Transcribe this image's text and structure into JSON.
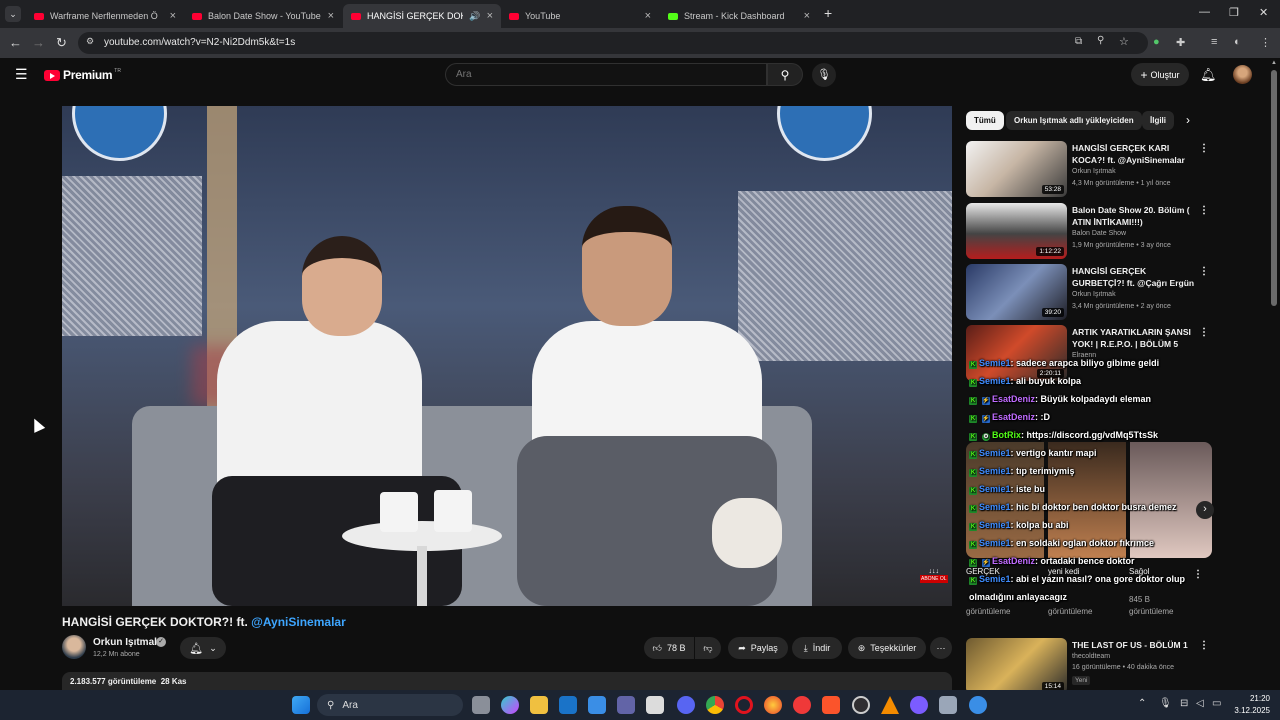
{
  "browser": {
    "tabs": [
      {
        "title": "Warframe Nerflenmeden Ö",
        "active": false
      },
      {
        "title": "Balon Date Show - YouTube",
        "active": false
      },
      {
        "title": "HANGİSİ GERÇEK DOKTOR",
        "active": true
      },
      {
        "title": "YouTube",
        "active": false
      },
      {
        "title": "Stream - Kick Dashboard",
        "active": false
      }
    ],
    "url": "youtube.com/watch?v=N2-Ni2Ddm5k&t=1s"
  },
  "header": {
    "logo_text": "Premium",
    "logo_region": "TR",
    "search_placeholder": "Ara",
    "create_label": "Oluştur"
  },
  "video": {
    "title_main": "HANGİSİ GERÇEK DOKTOR?! ft. ",
    "title_mention": "@AyniSinemalar",
    "channel": "Orkun Işıtmak",
    "subscribers": "12,2 Mn abone",
    "likes": "78 B",
    "share_label": "Paylaş",
    "download_label": "İndir",
    "thanks_label": "Teşekkürler",
    "views_date": "2.183.577 görüntüleme  28 Kas",
    "overlay_badge": "ABONE OL"
  },
  "chips": [
    {
      "label": "Tümü",
      "selected": true
    },
    {
      "label": "Orkun Işıtmak adlı yükleyiciden",
      "selected": false
    },
    {
      "label": "İlgili",
      "selected": false
    }
  ],
  "recommendations": [
    {
      "title": "HANGİSİ GERÇEK KARI KOCA?! ft. @AyniSinemalar",
      "channel": "Orkun Işıtmak",
      "meta": "4,3 Mn görüntüleme  •  1 yıl önce",
      "duration": "53:28"
    },
    {
      "title": "Balon Date Show 20. Bölüm ( ATIN İNTİKAMI!!!)",
      "channel": "Balon Date Show",
      "meta": "1,9 Mn görüntüleme  •  3 ay önce",
      "duration": "1:12:22"
    },
    {
      "title": "HANGİSİ GERÇEK GURBETÇİ?! ft. @Çağrı Ergün",
      "channel": "Orkun Işıtmak",
      "meta": "3,4 Mn görüntüleme  •  2 ay önce",
      "duration": "39:20"
    },
    {
      "title": "ARTIK YARATIKLARIN ŞANSI YOK! | R.E.P.O. | BÖLÜM 5",
      "channel": "Elraenn",
      "meta": "görüntüleme",
      "duration": "2:20:11"
    },
    {
      "title": "THE LAST OF US - BÖLÜM 1",
      "channel": "thecoldteam",
      "meta": "16 görüntüleme  •  40 dakika önce",
      "duration": "15:14",
      "badge": "Yeni"
    }
  ],
  "shorts": [
    {
      "label": "GERÇEK",
      "views": "görüntüleme"
    },
    {
      "label": "yeni kedi",
      "views": "görüntüleme"
    },
    {
      "label": "Sağol",
      "views": "845 B\ngörüntüleme"
    }
  ],
  "chat": [
    {
      "user": "Semie1",
      "text": ": sadece arapca biliyo gibime geldi",
      "color": "#3f8dff"
    },
    {
      "user": "Semie1",
      "text": ": ali buyuk kolpa",
      "color": "#3f8dff"
    },
    {
      "user": "EsatDeniz",
      "text": ": Büyük kolpadaydı eleman",
      "color": "#c06cff"
    },
    {
      "user": "EsatDeniz",
      "text": ": :D",
      "color": "#c06cff"
    },
    {
      "user": "BotRix",
      "text": ": https://discord.gg/vdMq5TtsSk",
      "color": "#53fc18"
    },
    {
      "user": "Semie1",
      "text": ": vertigo kantır mapi",
      "color": "#3f8dff"
    },
    {
      "user": "Semie1",
      "text": ": tıp terimiymiş",
      "color": "#3f8dff"
    },
    {
      "user": "Semie1",
      "text": ": iste bu",
      "color": "#3f8dff"
    },
    {
      "user": "Semie1",
      "text": ": hic bi doktor ben doktor busra demez",
      "color": "#3f8dff"
    },
    {
      "user": "Semie1",
      "text": ": kolpa bu abi",
      "color": "#3f8dff"
    },
    {
      "user": "Semie1",
      "text": ": en soldaki oglan doktor fıkrımce",
      "color": "#3f8dff"
    },
    {
      "user": "EsatDeniz",
      "text": ": ortadaki bence doktor",
      "color": "#c06cff"
    },
    {
      "user": "Semie1",
      "text": ": abi el yazın nasıl? ona gore doktor olup",
      "color": "#3f8dff"
    },
    {
      "user": "",
      "text": "olmadığını anlayacagız",
      "color": "#ffffff"
    }
  ],
  "taskbar": {
    "search_label": "Ara",
    "time": "21:20",
    "date": "3.12.2025"
  },
  "colors": {
    "background": "#0f0f0f",
    "accent_red": "#ff0033",
    "link_blue": "#3ea6ff",
    "kick_green": "#53fc18"
  }
}
